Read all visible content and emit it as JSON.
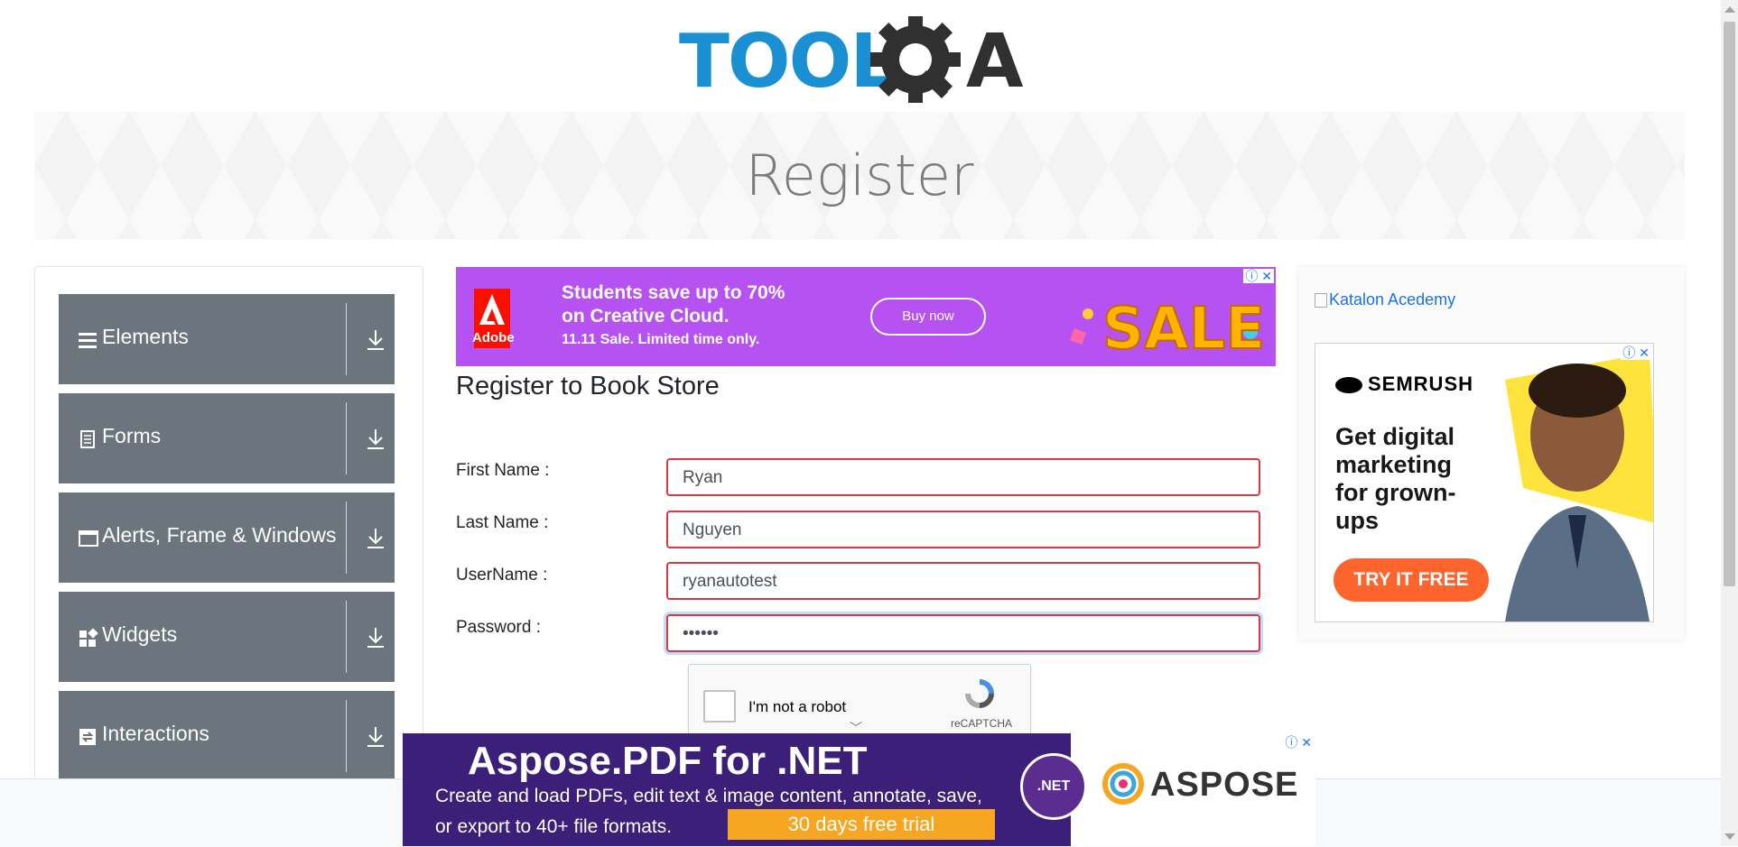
{
  "header": {
    "logo_left": "TOOLS",
    "logo_right": "QA"
  },
  "banner": {
    "title": "Register"
  },
  "sidebar": {
    "groups": [
      {
        "label": "Elements",
        "icon": "hamburger-icon"
      },
      {
        "label": "Forms",
        "icon": "document-icon"
      },
      {
        "label": "Alerts, Frame & Windows",
        "icon": "window-icon"
      },
      {
        "label": "Widgets",
        "icon": "widgets-icon"
      },
      {
        "label": "Interactions",
        "icon": "sync-icon"
      }
    ]
  },
  "ad_top": {
    "brand": "Adobe",
    "line1": "Students save up to 70%",
    "line2": "on Creative Cloud.",
    "line3": "11.11 Sale. Limited time only.",
    "button": "Buy now",
    "sale": "SALE"
  },
  "form": {
    "title": "Register to Book Store",
    "fields": [
      {
        "label": "First Name :",
        "value": "Ryan"
      },
      {
        "label": "Last Name :",
        "value": "Nguyen"
      },
      {
        "label": "UserName :",
        "value": "ryanautotest"
      },
      {
        "label": "Password :",
        "value": "••••••"
      }
    ]
  },
  "captcha": {
    "text": "I'm not a robot",
    "brand": "reCAPTCHA"
  },
  "right": {
    "katalon_alt": "Katalon Acedemy",
    "semrush": {
      "brand": "SEMRUSH",
      "headline": "Get digital marketing for grown-ups",
      "line1": "Get digital",
      "line2": "marketing",
      "line3": "for grown-",
      "line4": "ups",
      "button": "TRY IT FREE"
    }
  },
  "ad_bottom": {
    "title": "Aspose.PDF for .NET",
    "desc1": "Create and load PDFs, edit text & image content, annotate, save,",
    "desc2": "or export to 40+ file formats.",
    "trial": "30 days free trial",
    "net": ".NET",
    "brand": "ASPOSE"
  },
  "colors": {
    "sidebar_bg": "#6c757d",
    "invalid_border": "#dc3545",
    "logo_blue": "#1a8fd1",
    "logo_dark": "#303030"
  }
}
